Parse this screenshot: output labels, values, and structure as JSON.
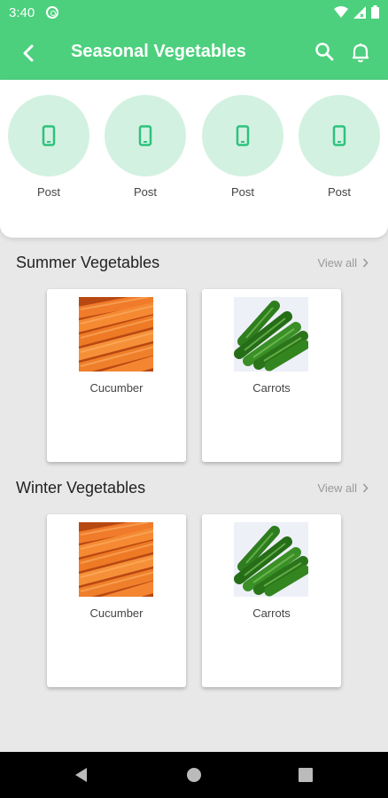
{
  "status_bar": {
    "time": "3:40"
  },
  "app_bar": {
    "title": "Seasonal Vegetables"
  },
  "posts": [
    {
      "label": "Post"
    },
    {
      "label": "Post"
    },
    {
      "label": "Post"
    },
    {
      "label": "Post"
    }
  ],
  "sections": [
    {
      "title": "Summer Vegetables",
      "view_all": "View all",
      "items": [
        {
          "label": "Cucumber",
          "image": "carrots-image"
        },
        {
          "label": "Carrots",
          "image": "cucumbers-image"
        }
      ]
    },
    {
      "title": "Winter Vegetables",
      "view_all": "View all",
      "items": [
        {
          "label": "Cucumber",
          "image": "carrots-image"
        },
        {
          "label": "Carrots",
          "image": "cucumbers-image"
        }
      ]
    }
  ],
  "colors": {
    "primary": "#4cd07d",
    "post_circle": "#d3f1e1",
    "icon": "#2ec27e"
  }
}
